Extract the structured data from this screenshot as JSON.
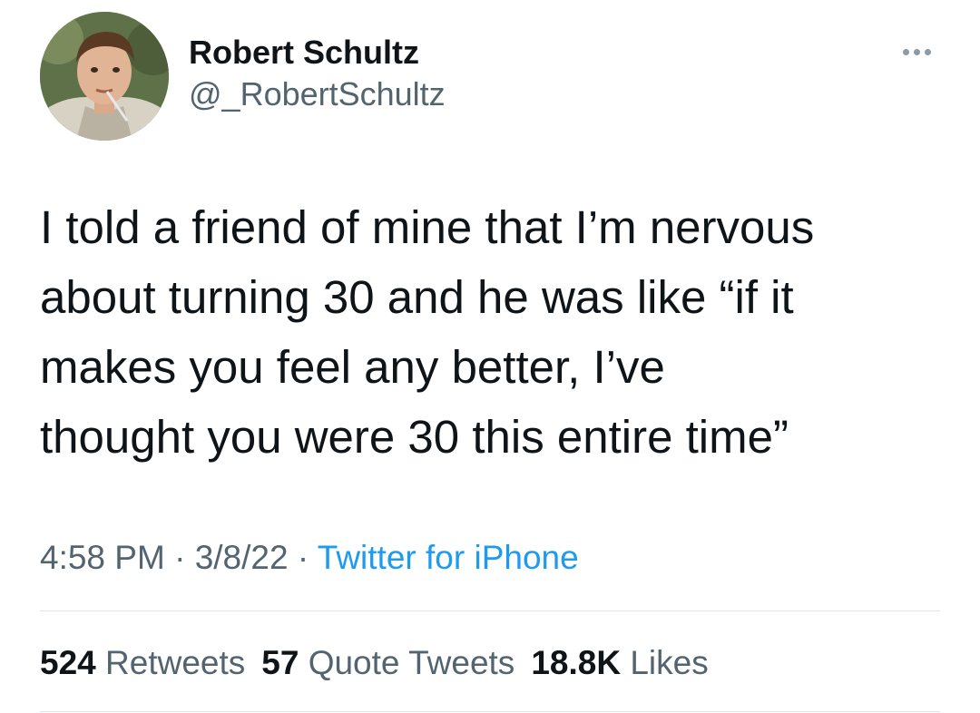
{
  "author": {
    "display_name": "Robert Schultz",
    "handle": "@_RobertSchultz"
  },
  "tweet": {
    "text": "I told a friend of mine that I’m nervous\nabout turning 30 and he was like “if it\nmakes you feel any better, I’ve\nthought you were 30 this entire time”"
  },
  "meta": {
    "time": "4:58 PM",
    "separator": " · ",
    "date": "3/8/22",
    "source": "Twitter for iPhone"
  },
  "stats": {
    "retweets_count": "524",
    "retweets_label": "Retweets",
    "quotes_count": "57",
    "quotes_label": "Quote Tweets",
    "likes_count": "18.8K",
    "likes_label": "Likes"
  },
  "icons": {
    "more": "more-horizontal-icon"
  },
  "colors": {
    "text": "#0f1419",
    "secondary": "#536471",
    "link": "#1d9bf0",
    "divider": "#dfe4e8"
  }
}
